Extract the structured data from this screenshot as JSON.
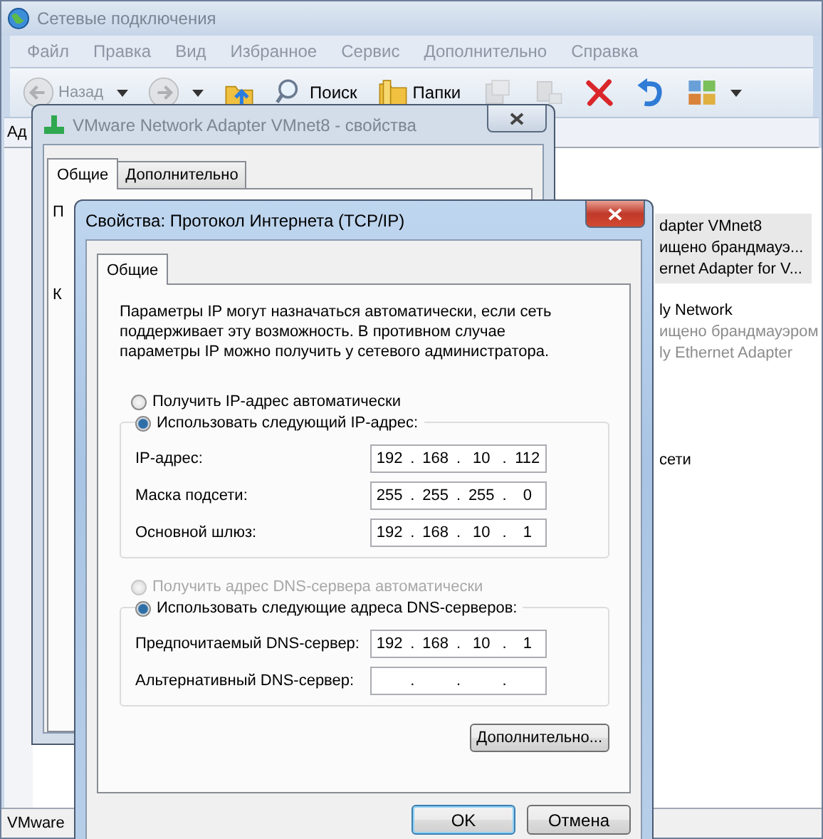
{
  "explorer": {
    "title": "Сетевые подключения",
    "menu": [
      "Файл",
      "Правка",
      "Вид",
      "Избранное",
      "Сервис",
      "Дополнительно",
      "Справка"
    ],
    "toolbar": [
      {
        "kind": "back",
        "label": "Назад",
        "disabled": true,
        "dropdown": true
      },
      {
        "kind": "forward",
        "disabled": true,
        "dropdown": true
      },
      {
        "kind": "up",
        "disabled": false,
        "dropdown": false
      },
      {
        "kind": "search",
        "label": "Поиск",
        "disabled": false,
        "dropdown": false
      },
      {
        "kind": "folders",
        "label": "Папки",
        "disabled": false,
        "dropdown": false
      },
      {
        "kind": "move",
        "disabled": true,
        "dropdown": false
      },
      {
        "kind": "copy",
        "disabled": true,
        "dropdown": false
      },
      {
        "kind": "delete",
        "disabled": false,
        "dropdown": false
      },
      {
        "kind": "undo",
        "disabled": false,
        "dropdown": false
      },
      {
        "kind": "views",
        "disabled": false,
        "dropdown": true
      }
    ],
    "address_label": "Ад",
    "connections": [
      {
        "lines": [
          "dapter VMnet8",
          "ищено брандмауэ...",
          "ernet Adapter for V..."
        ],
        "selected": true,
        "disabled": false
      },
      {
        "lines": [
          "ly Network",
          "ищено брандмауэром",
          "ly Ethernet Adapter"
        ],
        "selected": false,
        "disabled": true
      },
      {
        "lines": [
          "сети"
        ],
        "selected": false
      }
    ],
    "status_bar": "VMware"
  },
  "adapter_window": {
    "title": "VMware Network Adapter VMnet8 - свойства",
    "tabs": [
      {
        "label": "Общие",
        "selected": true
      },
      {
        "label": "Дополнительно",
        "selected": false
      }
    ],
    "fragments": [
      "П",
      "К"
    ]
  },
  "tcpip_dialog": {
    "title": "Свойства: Протокол Интернета (TCP/IP)",
    "tabs": [
      {
        "label": "Общие",
        "selected": true
      }
    ],
    "intro": "Параметры IP могут назначаться автоматически, если сеть поддерживает эту возможность. В противном случае параметры IP можно получить у сетевого администратора.",
    "octet_separator": ".",
    "ip_auto": {
      "label": "Получить IP-адрес автоматически",
      "selected": false,
      "disabled": false
    },
    "ip_group": {
      "label": "Использовать следующий IP-адрес:",
      "selected": true,
      "disabled": false,
      "fields": [
        {
          "label": "IP-адрес:",
          "octets": [
            "192",
            "168",
            "10",
            "112"
          ]
        },
        {
          "label": "Маска подсети:",
          "octets": [
            "255",
            "255",
            "255",
            "0"
          ]
        },
        {
          "label": "Основной шлюз:",
          "octets": [
            "192",
            "168",
            "10",
            "1"
          ]
        }
      ]
    },
    "dns_auto": {
      "label": "Получить адрес DNS-сервера автоматически",
      "selected": false,
      "disabled": true
    },
    "dns_group": {
      "label": "Использовать следующие адреса DNS-серверов:",
      "selected": true,
      "disabled": false,
      "fields": [
        {
          "label": "Предпочитаемый DNS-сервер:",
          "octets": [
            "192",
            "168",
            "10",
            "1"
          ]
        },
        {
          "label": "Альтернативный DNS-сервер:"
        }
      ]
    },
    "advanced_button": "Дополнительно...",
    "buttons": [
      {
        "label": "OK",
        "default": true
      },
      {
        "label": "Отмена",
        "default": false
      }
    ]
  }
}
